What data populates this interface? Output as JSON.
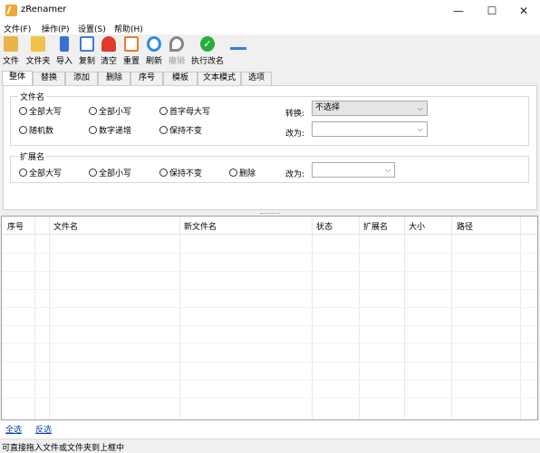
{
  "app": {
    "title": "zRenamer"
  },
  "window": {
    "minimize": "—",
    "maximize": "☐",
    "close": "✕"
  },
  "menu": [
    "文件(F)",
    "操作(P)",
    "设置(S)",
    "帮助(H)"
  ],
  "toolbar": [
    {
      "label": "文件",
      "icon": "file-icon",
      "color": "#e7b54a"
    },
    {
      "label": "文件夹",
      "icon": "folder-icon",
      "color": "#f0c14b"
    },
    {
      "label": "导入",
      "icon": "import-icon",
      "color": "#3a6fd8"
    },
    {
      "label": "复制",
      "icon": "copy-icon",
      "color": "#3d7bd9"
    },
    {
      "label": "清空",
      "icon": "clear-icon",
      "color": "#e03a2f"
    },
    {
      "label": "重置",
      "icon": "reset-icon",
      "color": "#e87a2f"
    },
    {
      "label": "刷新",
      "icon": "refresh-icon",
      "color": "#2f8be0"
    },
    {
      "label": "撤销",
      "icon": "undo-icon",
      "color": "#888888",
      "disabled": true
    },
    {
      "label": "执行改名",
      "icon": "check-icon",
      "color": "#27ae3c"
    }
  ],
  "pin_icon": "pin-icon",
  "tabs": [
    "整体",
    "替换",
    "添加",
    "删除",
    "序号",
    "模板",
    "文本模式",
    "选项"
  ],
  "filename_group": {
    "title": "文件名",
    "options": [
      "全部大写",
      "全部小写",
      "首字母大写",
      "随机数",
      "数字递增",
      "保持不变"
    ],
    "convert_label": "转换:",
    "convert_value": "不选择",
    "change_label": "改为:",
    "change_value": ""
  },
  "ext_group": {
    "title": "扩展名",
    "options": [
      "全部大写",
      "全部小写",
      "保持不变",
      "删除"
    ],
    "change_label": "改为:",
    "change_value": ""
  },
  "grid": {
    "columns": [
      "序号",
      "文件名",
      "新文件名",
      "状态",
      "扩展名",
      "大小",
      "路径"
    ]
  },
  "footer": {
    "select_all": "全选",
    "invert": "反选"
  },
  "status": "可直接拖入文件或文件夹到上框中"
}
